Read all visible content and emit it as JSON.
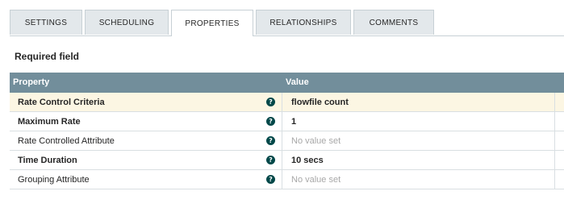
{
  "tabs": [
    {
      "label": "SETTINGS",
      "active": false
    },
    {
      "label": "SCHEDULING",
      "active": false
    },
    {
      "label": "PROPERTIES",
      "active": true
    },
    {
      "label": "RELATIONSHIPS",
      "active": false
    },
    {
      "label": "COMMENTS",
      "active": false
    }
  ],
  "required_label": "Required field",
  "table": {
    "headers": {
      "property": "Property",
      "value": "Value"
    },
    "rows": [
      {
        "property": "Rate Control Criteria",
        "value": "flowfile count",
        "required": true,
        "value_set": true,
        "selected": true
      },
      {
        "property": "Maximum Rate",
        "value": "1",
        "required": true,
        "value_set": true,
        "selected": false
      },
      {
        "property": "Rate Controlled Attribute",
        "value": "No value set",
        "required": false,
        "value_set": false,
        "selected": false
      },
      {
        "property": "Time Duration",
        "value": "10 secs",
        "required": true,
        "value_set": true,
        "selected": false
      },
      {
        "property": "Grouping Attribute",
        "value": "No value set",
        "required": false,
        "value_set": false,
        "selected": false
      }
    ]
  },
  "icons": {
    "info": "question-circle-icon",
    "info_glyph": "?"
  },
  "colors": {
    "header_bg": "#728e9b",
    "selected_row": "#fcf6e3",
    "icon": "#004849",
    "unset_text": "#a8a8a8"
  }
}
